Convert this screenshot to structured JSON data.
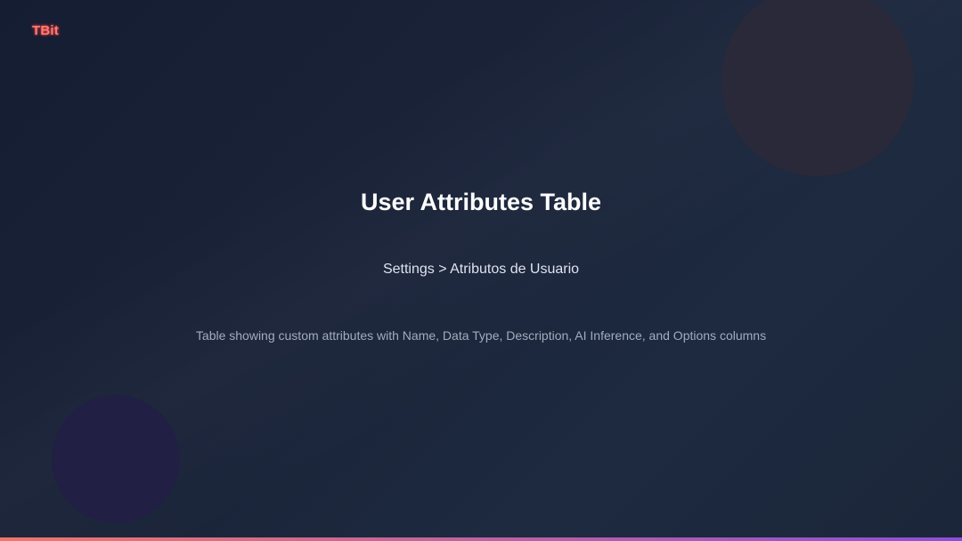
{
  "brand": {
    "logo_text": "TBit",
    "logo_color": "#ff7a70"
  },
  "slide": {
    "title": "User Attributes Table",
    "breadcrumb": "Settings > Atributos de Usuario",
    "description": "Table showing custom attributes with Name, Data Type, Description, AI Inference, and Options columns"
  },
  "colors": {
    "background": "#1a2338",
    "accent_bar_start": "#f0766a",
    "accent_bar_end": "#8b4fd8"
  }
}
